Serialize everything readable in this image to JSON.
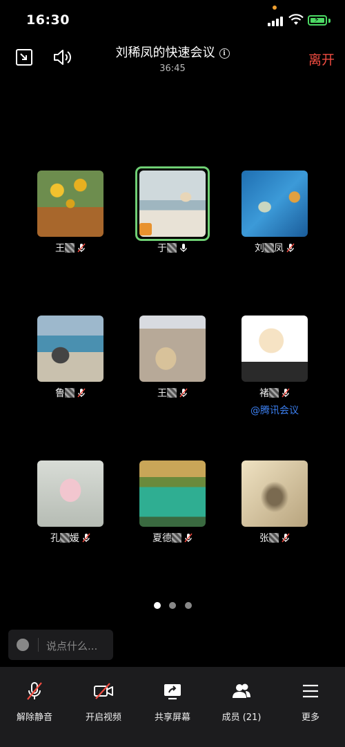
{
  "status_bar": {
    "time": "16:30"
  },
  "header": {
    "title": "刘稀凤的快速会议",
    "timer": "36:45",
    "leave_label": "离开",
    "icons": [
      "minimize-window-icon",
      "speaker-icon",
      "info-icon"
    ]
  },
  "participants": [
    {
      "name": "王",
      "mic": "muted",
      "tile": "sunflowers"
    },
    {
      "name": "于",
      "mic": "on",
      "tile": "beach-girl",
      "active": true
    },
    {
      "name": "刘",
      "name_tail": "凤",
      "mic": "muted",
      "tile": "water-leaf"
    },
    {
      "name": "鲁",
      "mic": "muted",
      "tile": "man-by-lake"
    },
    {
      "name": "王",
      "mic": "muted",
      "tile": "rabbit-arch"
    },
    {
      "name": "褚",
      "mic": "muted",
      "tile": "monk-cartoon",
      "tag": "@腾讯会议"
    },
    {
      "name": "孔",
      "name_tail": "媛",
      "mic": "muted",
      "tile": "lotus"
    },
    {
      "name": "夏德",
      "mic": "muted",
      "tile": "green-lake"
    },
    {
      "name": "张",
      "mic": "muted",
      "tile": "shadow"
    }
  ],
  "pager": {
    "pages": 3,
    "current": 1
  },
  "chat": {
    "placeholder": "说点什么..."
  },
  "bottom_bar": {
    "items": [
      {
        "label": "解除静音",
        "icon": "mic-muted-icon"
      },
      {
        "label": "开启视频",
        "icon": "video-off-icon"
      },
      {
        "label": "共享屏幕",
        "icon": "share-screen-icon"
      },
      {
        "label": "成员 (21)",
        "icon": "members-icon"
      },
      {
        "label": "更多",
        "icon": "menu-icon"
      }
    ]
  },
  "colors": {
    "leave": "#f14c41",
    "active_border": "#6fcf74",
    "tag": "#3b7ff0",
    "battery": "#4cd964"
  }
}
